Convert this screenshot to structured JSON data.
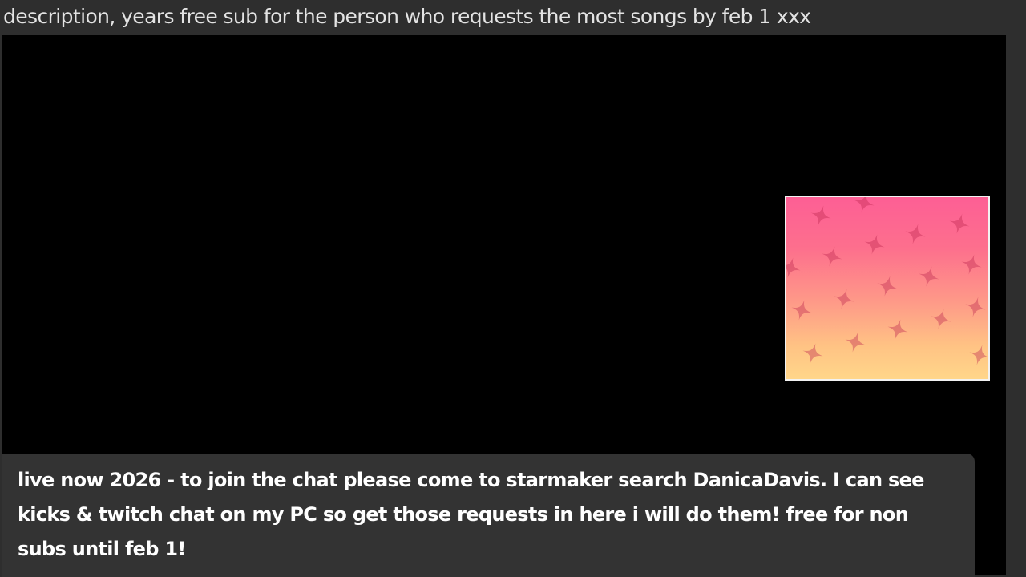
{
  "ticker": {
    "text": "description, years free sub for the person who requests the most songs by feb 1 xxx"
  },
  "overlay": {
    "image_icon": "pink-stars-gradient-image",
    "colors": {
      "top": "#fd5f95",
      "bottom": "#ffd68a",
      "stars": "#be2850"
    }
  },
  "chat": {
    "message": "live now 2026 - to join the chat please come to starmaker search DanicaDavis. I can see kicks & twitch chat on my PC so get those requests in here i will do them! free for non subs until feb 1!"
  }
}
